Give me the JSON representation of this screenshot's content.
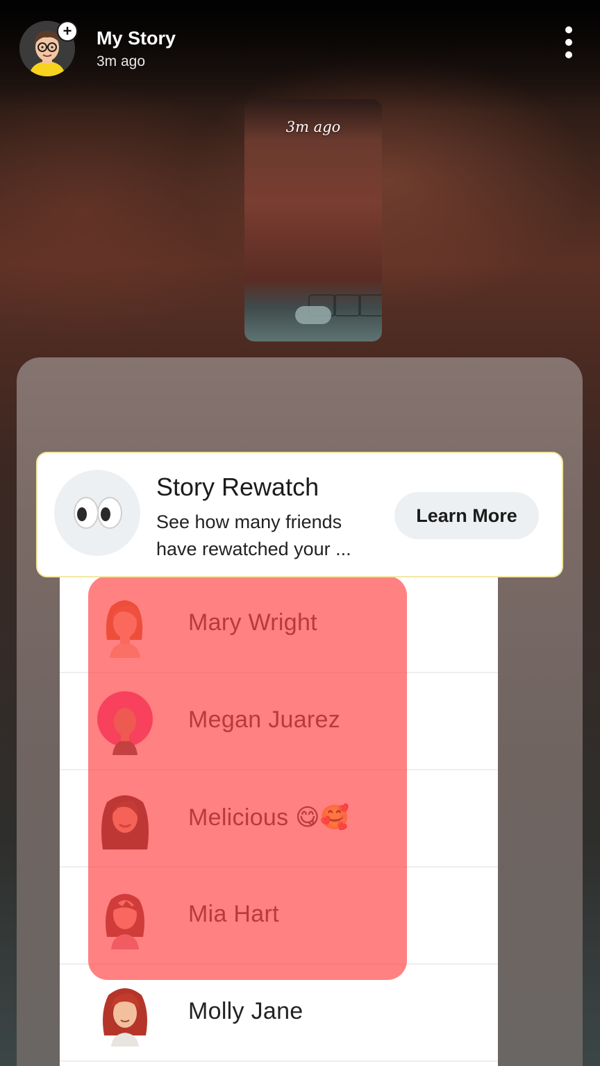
{
  "header": {
    "title": "My Story",
    "subtitle": "3m ago"
  },
  "thumbnail": {
    "timestamp": "3m ago"
  },
  "rewatch_card": {
    "title": "Story Rewatch",
    "description_line1": "See how many friends",
    "description_line2": "have rewatched your ...",
    "button_label": "Learn More",
    "icon": "eyes-emoji-icon"
  },
  "viewers": [
    {
      "name": "Mary Wright"
    },
    {
      "name": "Megan Juarez"
    },
    {
      "name": "Melicious 😋🥰"
    },
    {
      "name": "Mia Hart"
    },
    {
      "name": "Molly Jane"
    }
  ],
  "colors": {
    "highlight": "#ff4646",
    "card_border": "#f3e7a0",
    "button_bg": "#edf0f2"
  }
}
